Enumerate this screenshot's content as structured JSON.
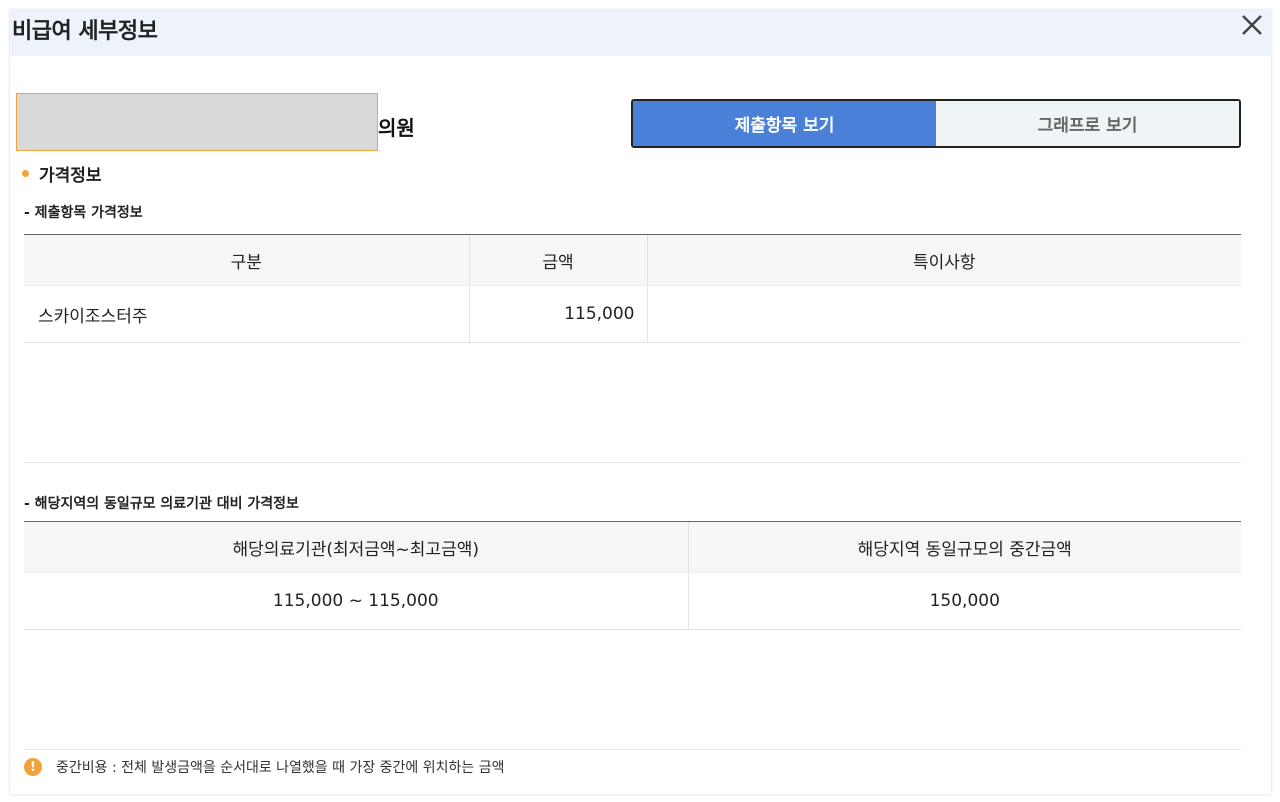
{
  "modal": {
    "title": "비급여 세부정보",
    "close_icon": "close-icon"
  },
  "clinic": {
    "name_suffix": "의원"
  },
  "view_toggle": {
    "submitted_label": "제출항목 보기",
    "graph_label": "그래프로 보기",
    "active": "submitted"
  },
  "price_section": {
    "title": "가격정보",
    "submitted_subtitle": "- 제출항목 가격정보",
    "submitted_table": {
      "headers": [
        "구분",
        "금액",
        "특이사항"
      ],
      "rows": [
        {
          "item": "스카이조스터주",
          "amount": "115,000",
          "note": ""
        }
      ]
    },
    "regional_subtitle": "- 해당지역의 동일규모 의료기관 대비 가격정보",
    "regional_table": {
      "headers": [
        "해당의료기관(최저금액~최고금액)",
        "해당지역 동일규모의 중간금액"
      ],
      "rows": [
        {
          "range": "115,000 ~ 115,000",
          "median": "150,000"
        }
      ]
    }
  },
  "footnote": {
    "icon": "warning-icon",
    "text": "중간비용 : 전체 발생금액을 순서대로 나열했을 때 가장 중간에 위치하는 금액"
  },
  "colors": {
    "header_bg": "#eef3fb",
    "accent_blue": "#4a80d8",
    "accent_orange": "#f0a23b"
  }
}
